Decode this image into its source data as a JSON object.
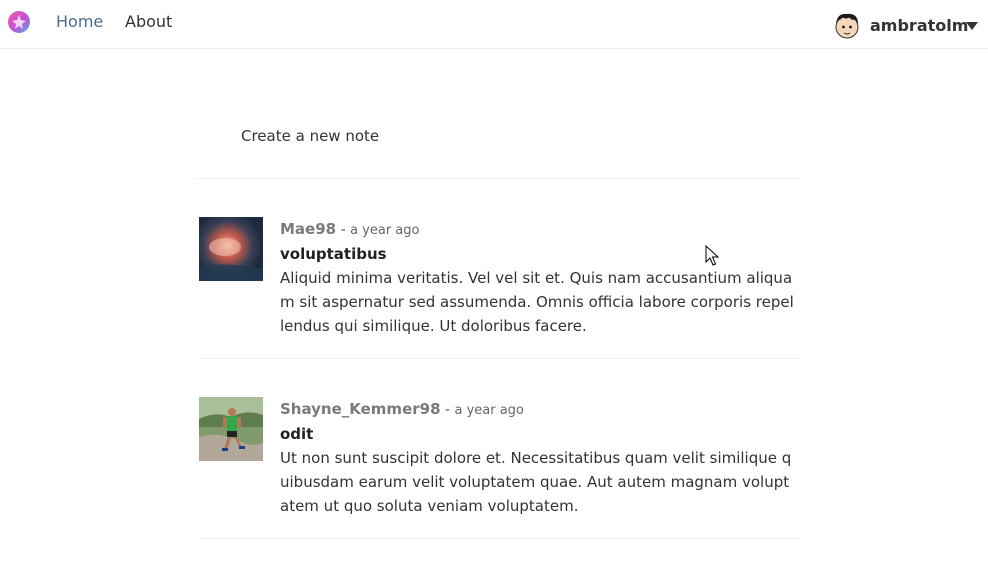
{
  "navbar": {
    "logo_icon": "brand-logo",
    "links": [
      {
        "label": "Home",
        "active": true
      },
      {
        "label": "About",
        "active": false
      }
    ],
    "user": {
      "name": "ambratolm",
      "avatar_icon": "cartoon-face-avatar",
      "menu_icon": "caret-down-icon"
    }
  },
  "composer": {
    "label": "Create a new note"
  },
  "notes": [
    {
      "author": "Mae98",
      "separator": "-",
      "time": "a year ago",
      "title": "voluptatibus",
      "body": "Aliquid minima veritatis. Vel vel sit et. Quis nam accusantium aliquam sit aspernatur sed assumenda. Omnis officia labore corporis repellendus qui similique. Ut doloribus facere.",
      "avatar_icon": "photo-avatar"
    },
    {
      "author": "Shayne_Kemmer98",
      "separator": "-",
      "time": "a year ago",
      "title": "odit",
      "body": "Ut non sunt suscipit dolore et. Necessitatibus quam velit similique quibusdam earum velit voluptatem quae. Aut autem magnam voluptatem ut quo soluta veniam voluptatem.",
      "avatar_icon": "photo-avatar"
    }
  ],
  "colors": {
    "active_link": "#4a6d8c",
    "text": "#333333",
    "meta": "#777777",
    "divider": "#f0f0f0"
  }
}
